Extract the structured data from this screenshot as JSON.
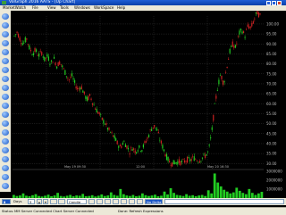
{
  "window": {
    "title": "VolGraph 2016 AATS - [Up Chart]",
    "controls": [
      "minimize-icon",
      "maximize-icon",
      "close-icon"
    ]
  },
  "menu": {
    "items": [
      "MarketWatch",
      "File",
      "View",
      "Tools",
      "Windows",
      "WorkSpace",
      "Help"
    ]
  },
  "toolbar": {
    "days_label": "Days",
    "days_value": "5",
    "candle_label": "Candle",
    "tab_label": "No Delta"
  },
  "status": {
    "label": "Status:",
    "server": "MM Server Connected  Chart Server Connected",
    "message": "Done: Refresh Expressions"
  },
  "colors": {
    "background": "#000000",
    "up_candle": "#22cc22",
    "down_candle": "#cc2222",
    "volume": "#22cc22",
    "grid": "#404040",
    "axis_text": "#bbbbbb",
    "accent": "#0a3fa8"
  },
  "chart_data": {
    "type": "candlestick",
    "grid": true,
    "y_axis": {
      "position": "right",
      "ticks": [
        100,
        95,
        90,
        85,
        80,
        75,
        70,
        65,
        60,
        55,
        50,
        45,
        40,
        35,
        30
      ],
      "range": [
        27,
        104
      ]
    },
    "x_axis": {
      "labels": [
        "May 19 09:30",
        "12:00",
        "May 20 16:30"
      ]
    },
    "price_path": [
      [
        0,
        94
      ],
      [
        4,
        96
      ],
      [
        8,
        92
      ],
      [
        12,
        90
      ],
      [
        16,
        93
      ],
      [
        20,
        88
      ],
      [
        24,
        85
      ],
      [
        28,
        87
      ],
      [
        32,
        84
      ],
      [
        36,
        86
      ],
      [
        40,
        82
      ],
      [
        44,
        84
      ],
      [
        48,
        80
      ],
      [
        52,
        83
      ],
      [
        56,
        79
      ],
      [
        60,
        81
      ],
      [
        64,
        78
      ],
      [
        68,
        75
      ],
      [
        72,
        72
      ],
      [
        76,
        74
      ],
      [
        80,
        70
      ],
      [
        84,
        67
      ],
      [
        88,
        69
      ],
      [
        92,
        65
      ],
      [
        96,
        62
      ],
      [
        100,
        64
      ],
      [
        104,
        60
      ],
      [
        108,
        57
      ],
      [
        112,
        55
      ],
      [
        116,
        52
      ],
      [
        120,
        50
      ],
      [
        124,
        47
      ],
      [
        128,
        45
      ],
      [
        132,
        43
      ],
      [
        136,
        40
      ],
      [
        140,
        38
      ],
      [
        144,
        41
      ],
      [
        148,
        39
      ],
      [
        152,
        36
      ],
      [
        156,
        38
      ],
      [
        160,
        36
      ],
      [
        164,
        38
      ],
      [
        168,
        37
      ],
      [
        172,
        40
      ],
      [
        176,
        43
      ],
      [
        180,
        47
      ],
      [
        184,
        49
      ],
      [
        188,
        47
      ],
      [
        192,
        42
      ],
      [
        196,
        38
      ],
      [
        200,
        34
      ],
      [
        204,
        31
      ],
      [
        208,
        30
      ],
      [
        212,
        30.5
      ],
      [
        216,
        31
      ],
      [
        220,
        30.5
      ],
      [
        224,
        31
      ],
      [
        228,
        32
      ],
      [
        232,
        31.5
      ],
      [
        236,
        33
      ],
      [
        240,
        32
      ],
      [
        244,
        31.5
      ],
      [
        248,
        33
      ],
      [
        252,
        34
      ],
      [
        256,
        36
      ],
      [
        260,
        45
      ],
      [
        264,
        58
      ],
      [
        268,
        68
      ],
      [
        272,
        75
      ],
      [
        276,
        70
      ],
      [
        280,
        78
      ],
      [
        284,
        86
      ],
      [
        288,
        90
      ],
      [
        292,
        88
      ],
      [
        296,
        95
      ],
      [
        300,
        97
      ],
      [
        304,
        94
      ],
      [
        308,
        99
      ],
      [
        312,
        98
      ],
      [
        316,
        102
      ],
      [
        320,
        106
      ],
      [
        324,
        104
      ]
    ],
    "volume_range": [
      0,
      3000000
    ],
    "volume_ticks": [
      "3000000",
      "2000000",
      "1000000"
    ],
    "volume_profile": [
      0.12,
      0.08,
      0.1,
      0.18,
      0.09,
      0.07,
      0.11,
      0.15,
      0.08,
      0.06,
      0.09,
      0.13,
      0.07,
      0.1,
      0.2,
      0.08,
      0.06,
      0.09,
      0.12,
      0.07,
      0.1,
      0.09,
      0.16,
      0.07,
      0.08,
      0.11,
      0.06,
      0.09,
      0.14,
      0.08,
      0.1,
      0.22,
      0.12,
      0.09,
      0.35,
      0.15,
      0.1,
      0.08,
      0.12,
      0.07,
      0.09,
      0.18,
      0.11,
      0.08,
      0.1,
      0.13,
      0.07,
      0.09,
      0.25,
      0.14,
      0.38,
      0.2,
      0.12,
      0.1,
      0.08,
      0.15,
      0.09,
      0.11,
      0.07,
      0.1,
      0.12,
      0.08,
      0.3,
      0.18,
      0.95,
      0.6,
      0.45,
      0.32,
      0.25,
      0.18,
      0.22,
      0.4,
      0.28,
      0.2,
      0.15,
      0.35,
      0.2,
      0.12,
      0.18,
      0.24
    ]
  }
}
